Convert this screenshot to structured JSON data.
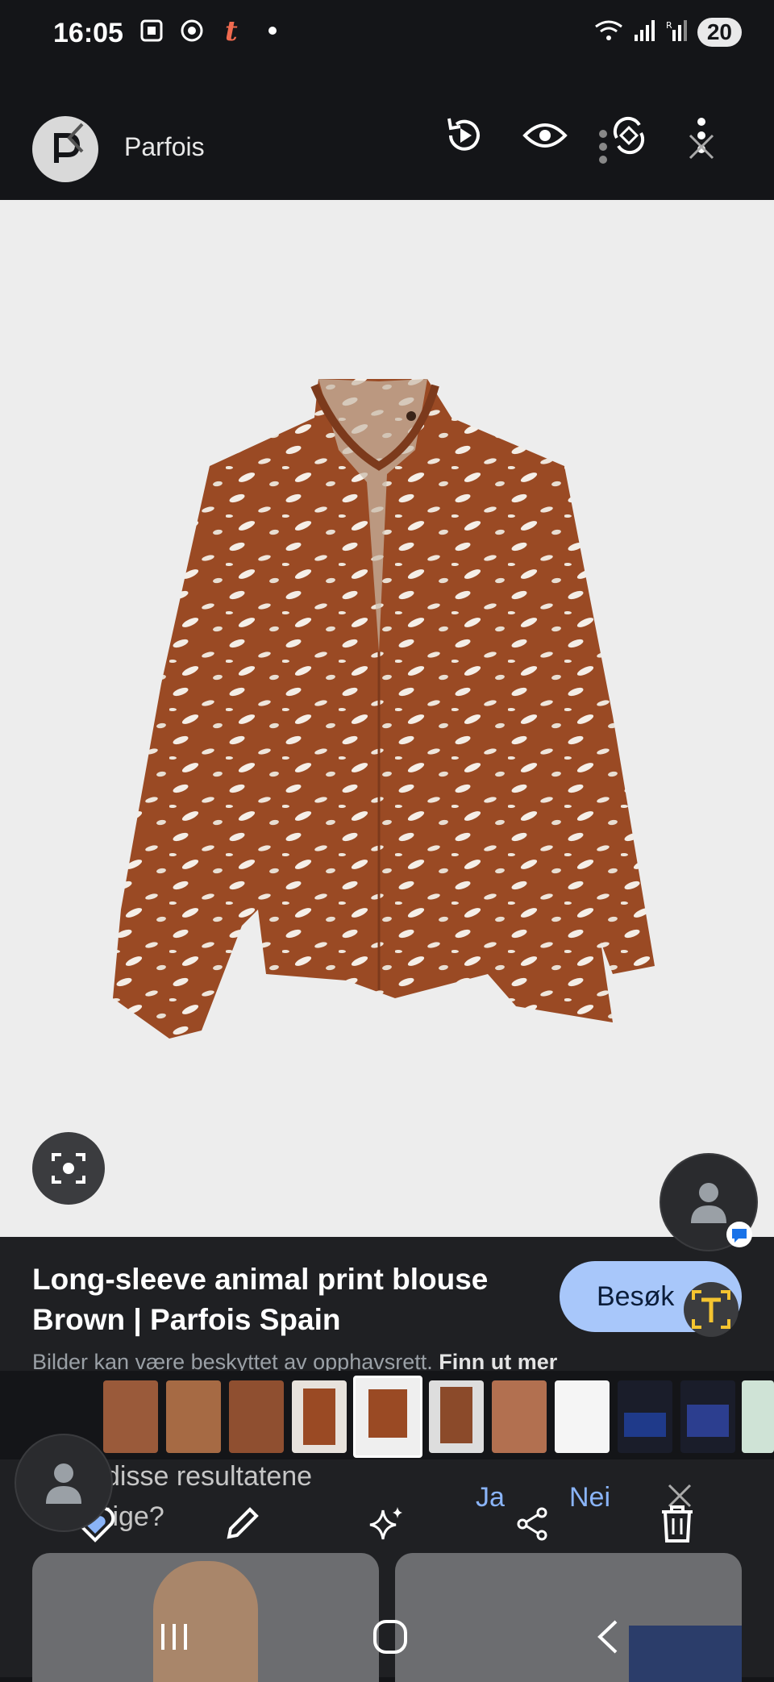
{
  "status_bar": {
    "time": "16:05",
    "battery": "20"
  },
  "header": {
    "site_name": "Parfois"
  },
  "result": {
    "title": "Long-sleeve animal print blouse Brown | Parfois Spain",
    "visit_label": "Besøk",
    "copyright_text": "Bilder kan være beskyttet av opphavsrett.",
    "learn_more": "Finn ut mer"
  },
  "feedback": {
    "question_line1": "disse resultatene",
    "question_line2": "tige?",
    "yes": "Ja",
    "no": "Nei"
  },
  "icons": {
    "status": [
      "screenshot-icon",
      "chrome-icon",
      "tumblr-icon",
      "dot-icon"
    ],
    "status_right": [
      "wifi-icon",
      "signal-icon",
      "signal-r-icon",
      "battery-icon"
    ],
    "header": [
      "back-icon",
      "replay-icon",
      "eye-icon",
      "rotate-icon",
      "more-icon",
      "close-icon"
    ],
    "toolbar": [
      "heart-icon",
      "edit-icon",
      "sparkle-icon",
      "share-icon",
      "delete-icon"
    ],
    "nav": [
      "recent-apps-icon",
      "home-icon",
      "back-nav-icon"
    ]
  },
  "colors": {
    "accent": "#a8c7fa",
    "link": "#8ab4f8",
    "blouse": "#9a4a24"
  }
}
